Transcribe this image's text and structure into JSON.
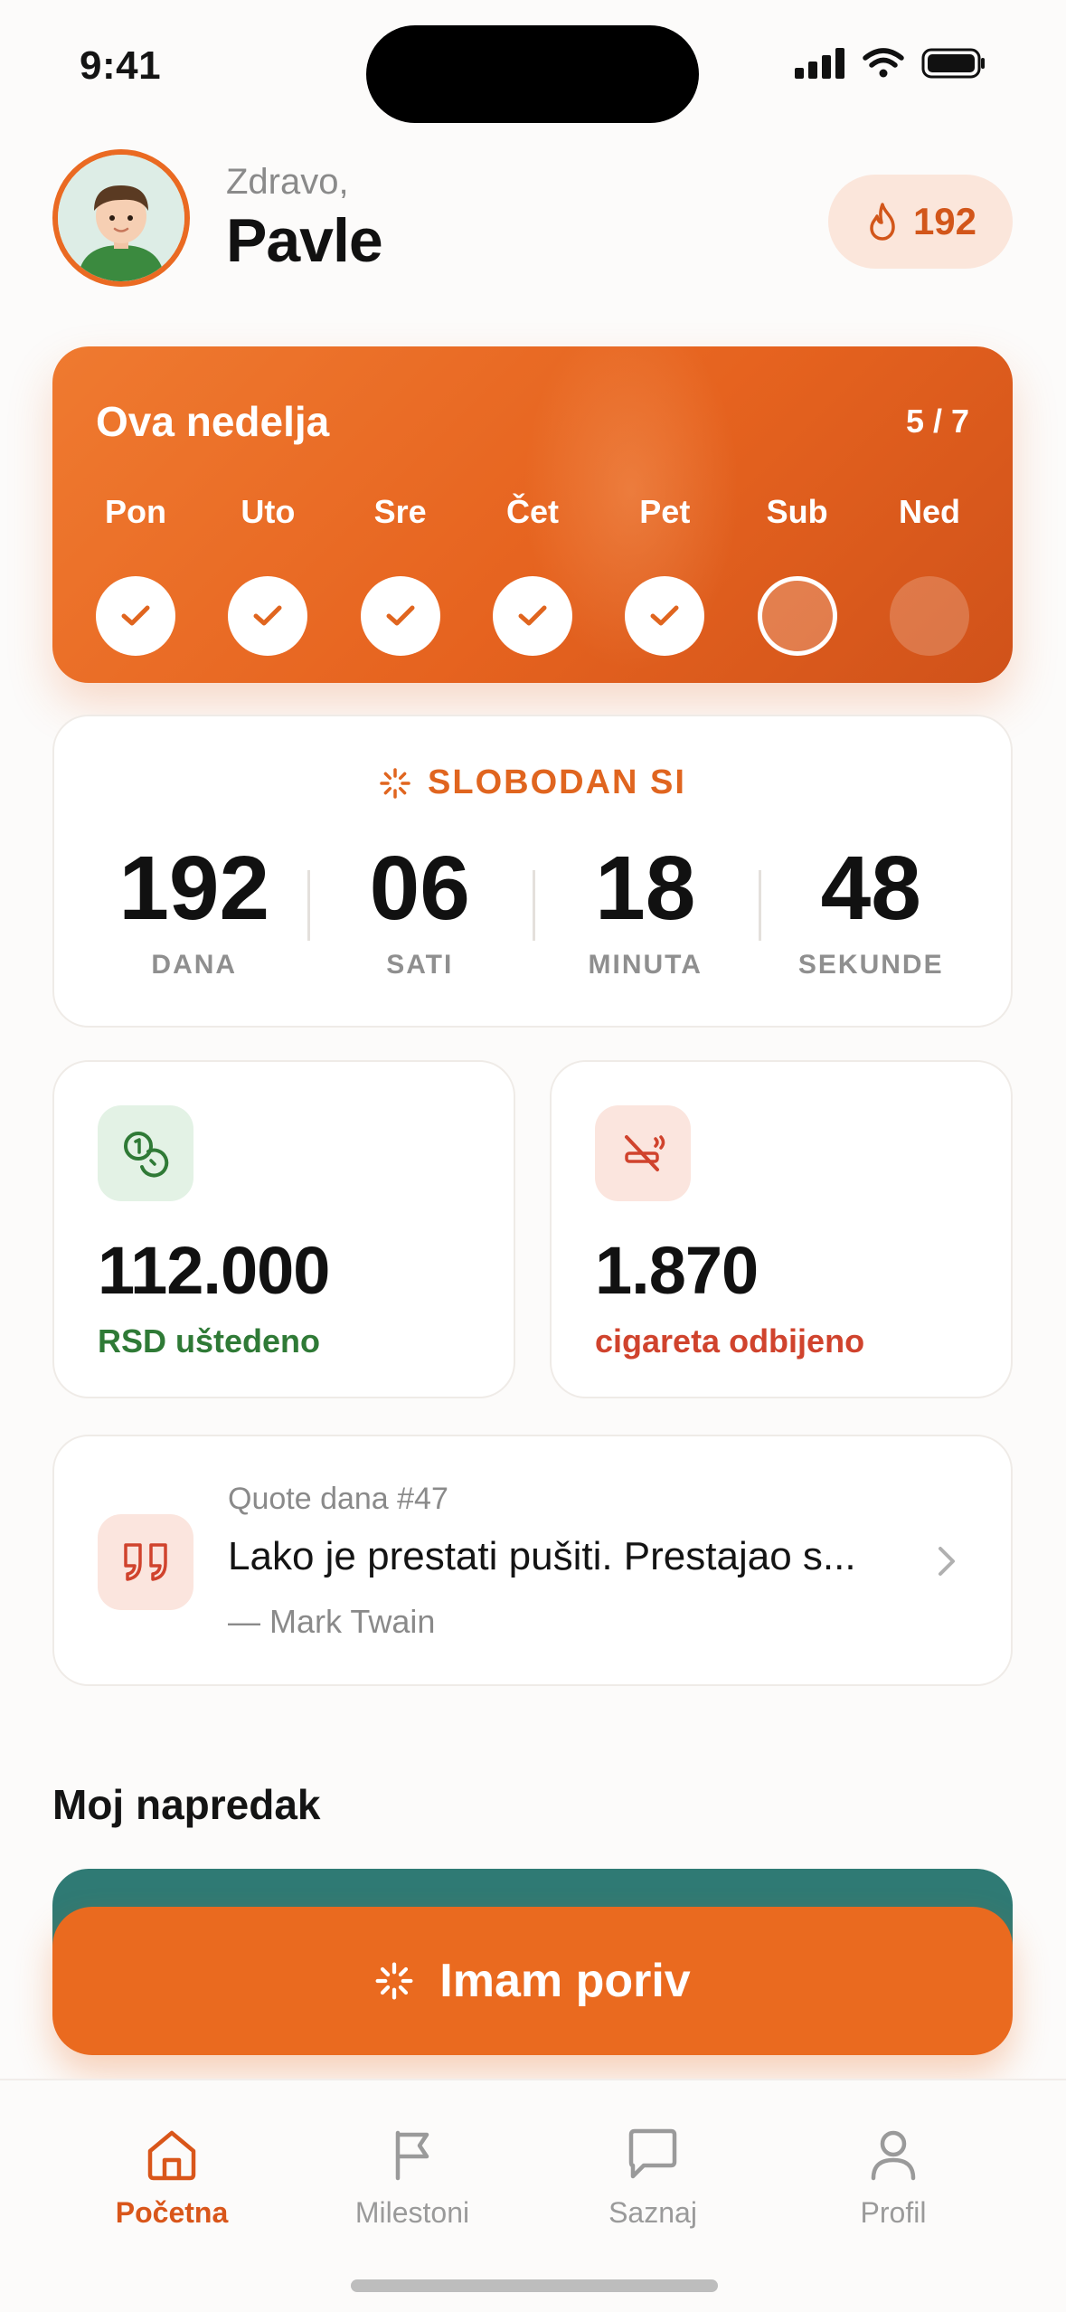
{
  "status_bar": {
    "time": "9:41"
  },
  "header": {
    "greeting": "Zdravo,",
    "name": "Pavle",
    "streak_count": "192",
    "icons": {
      "avatar": "avatar-boy",
      "streak": "flame-icon"
    }
  },
  "week": {
    "title": "Ova nedelja",
    "count": "5 / 7",
    "days": [
      {
        "label": "Pon",
        "state": "done"
      },
      {
        "label": "Uto",
        "state": "done"
      },
      {
        "label": "Sre",
        "state": "done"
      },
      {
        "label": "Čet",
        "state": "done"
      },
      {
        "label": "Pet",
        "state": "done"
      },
      {
        "label": "Sub",
        "state": "today"
      },
      {
        "label": "Ned",
        "state": "future"
      }
    ]
  },
  "free": {
    "label": "SLOBODAN SI",
    "units": [
      {
        "value": "192",
        "label": "DANA"
      },
      {
        "value": "06",
        "label": "SATI"
      },
      {
        "value": "18",
        "label": "MINUTA"
      },
      {
        "value": "48",
        "label": "SEKUNDE"
      }
    ]
  },
  "stats": {
    "saved": {
      "value": "112.000",
      "label": "RSD uštedeno",
      "icon": "coins-icon"
    },
    "refused": {
      "value": "1.870",
      "label": "cigareta odbijeno",
      "icon": "no-smoking-icon"
    }
  },
  "quote": {
    "meta": "Quote dana #47",
    "text": "Lako je prestati pušiti. Prestajao s...",
    "author": "— Mark Twain",
    "icon": "quote-icon"
  },
  "progress": {
    "title": "Moj napredak"
  },
  "cta": {
    "label": "Imam poriv",
    "icon": "spark-icon"
  },
  "tabs": [
    {
      "label": "Početna",
      "icon": "home-icon",
      "active": true
    },
    {
      "label": "Milestoni",
      "icon": "flag-icon",
      "active": false
    },
    {
      "label": "Saznaj",
      "icon": "chat-icon",
      "active": false
    },
    {
      "label": "Profil",
      "icon": "user-icon",
      "active": false
    }
  ],
  "colors": {
    "accent": "#EA6A1F",
    "green": "#2F7A36",
    "red": "#D0432D",
    "background": "#FCFBFA"
  }
}
